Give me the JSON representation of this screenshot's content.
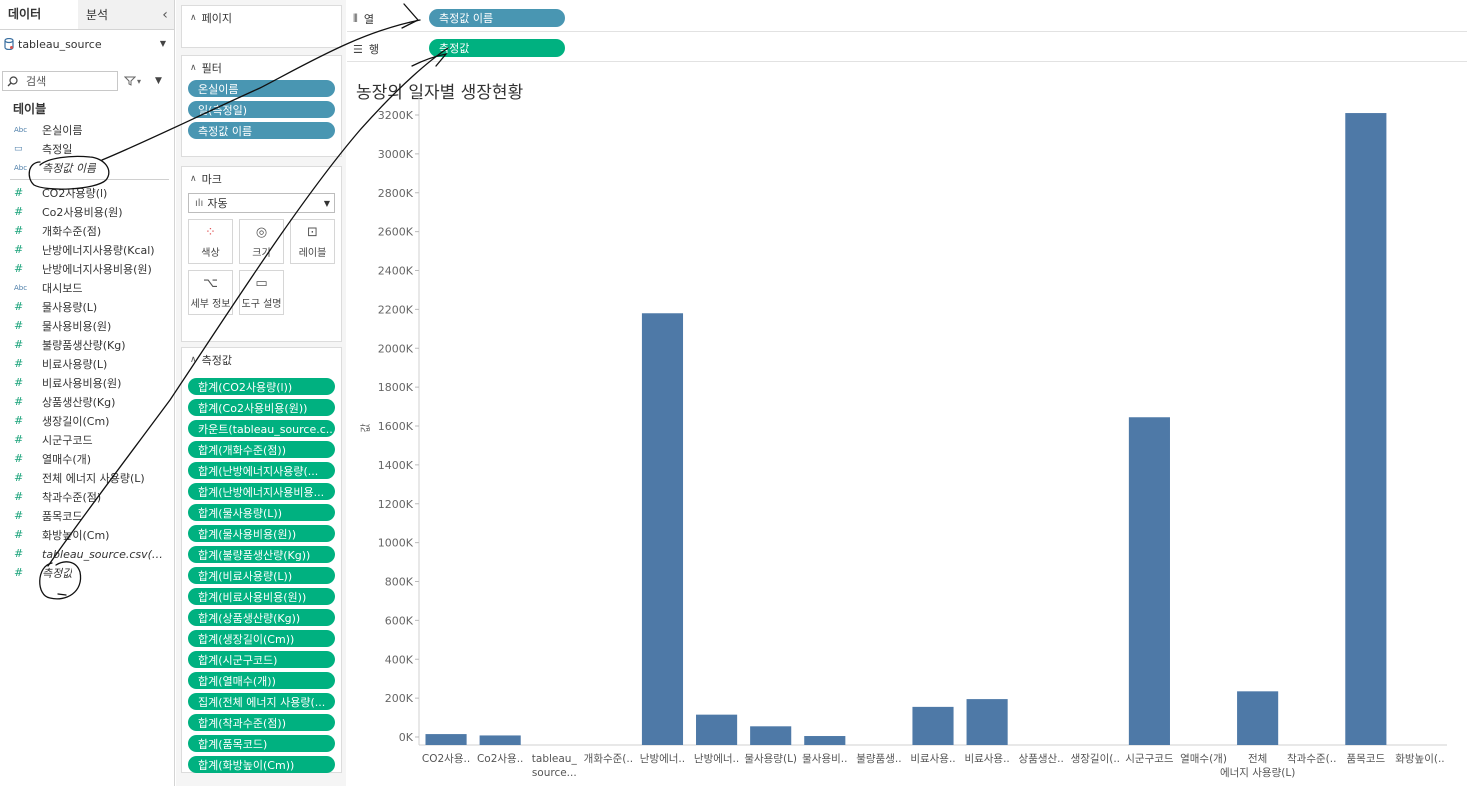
{
  "data_pane": {
    "tabs": [
      "데이터",
      "분석"
    ],
    "source_name": "tableau_source",
    "search_placeholder": "검색",
    "tables_header": "테이블",
    "fields": [
      {
        "type": "abc",
        "name": "온실이름"
      },
      {
        "type": "cal",
        "name": "측정일"
      },
      {
        "type": "abc",
        "name": "측정값 이름",
        "italic": true,
        "sep_after": true
      },
      {
        "type": "num",
        "name": "CO2사용량(l)"
      },
      {
        "type": "num",
        "name": "Co2사용비용(원)"
      },
      {
        "type": "num",
        "name": "개화수준(점)"
      },
      {
        "type": "num",
        "name": "난방에너지사용량(Kcal)"
      },
      {
        "type": "num",
        "name": "난방에너지사용비용(원)"
      },
      {
        "type": "abc",
        "name": "대시보드"
      },
      {
        "type": "num",
        "name": "물사용량(L)"
      },
      {
        "type": "num",
        "name": "물사용비용(원)"
      },
      {
        "type": "num",
        "name": "불량품생산량(Kg)"
      },
      {
        "type": "num",
        "name": "비료사용량(L)"
      },
      {
        "type": "num",
        "name": "비료사용비용(원)"
      },
      {
        "type": "num",
        "name": "상품생산량(Kg)"
      },
      {
        "type": "num",
        "name": "생장길이(Cm)"
      },
      {
        "type": "num",
        "name": "시군구코드"
      },
      {
        "type": "num",
        "name": "열매수(개)"
      },
      {
        "type": "num",
        "name": "전체 에너지 사용량(L)"
      },
      {
        "type": "num",
        "name": "착과수준(점)"
      },
      {
        "type": "num",
        "name": "품목코드"
      },
      {
        "type": "num",
        "name": "화방높이(Cm)"
      },
      {
        "type": "num",
        "name": "tableau_source.csv(카...",
        "italic": true
      },
      {
        "type": "num",
        "name": "측정값",
        "italic": true
      }
    ]
  },
  "cards": {
    "pages": "페이지",
    "filters": "필터",
    "filter_pills": [
      "온실이름",
      "일(측정일)",
      "측정값 이름"
    ],
    "marks": "마크",
    "marks_type": "자동",
    "mark_buttons": [
      "색상",
      "크기",
      "레이블",
      "세부 정보",
      "도구 설명"
    ],
    "measures": "측정값",
    "measure_pills": [
      "합계(CO2사용량(l))",
      "합계(Co2사용비용(원))",
      "카운트(tableau_source.c...",
      "합계(개화수준(점))",
      "합계(난방에너지사용량(...",
      "합계(난방에너지사용비용...",
      "합계(물사용량(L))",
      "합계(물사용비용(원))",
      "합계(불량품생산량(Kg))",
      "합계(비료사용량(L))",
      "합계(비료사용비용(원))",
      "합계(상품생산량(Kg))",
      "합계(생장길이(Cm))",
      "합계(시군구코드)",
      "합계(열매수(개))",
      "집계(전체 에너지 사용량(...",
      "합계(착과수준(점))",
      "합계(품목코드)",
      "합계(화방높이(Cm))"
    ]
  },
  "shelves": {
    "columns_label": "열",
    "columns_pill": "측정값 이름",
    "rows_label": "행",
    "rows_pill": "측정값"
  },
  "viz": {
    "title": "농장의 일자별 생장현황"
  },
  "colors": {
    "bar": "#4e79a7",
    "pill_blue": "#4996b2",
    "pill_green": "#00b180"
  },
  "chart_data": {
    "type": "bar",
    "title": "농장의 일자별 생장현황",
    "ylabel": "값",
    "xlabel": "",
    "ylim": [
      0,
      3200000
    ],
    "yticks": [
      "0K",
      "200K",
      "400K",
      "600K",
      "800K",
      "1000K",
      "1200K",
      "1400K",
      "1600K",
      "1800K",
      "2000K",
      "2200K",
      "2400K",
      "2600K",
      "2800K",
      "3000K",
      "3200K"
    ],
    "categories": [
      "CO2사용..",
      "Co2사용..",
      "tableau_ source...",
      "개화수준(..",
      "난방에너..",
      "난방에너..",
      "물사용량(L)",
      "물사용비..",
      "불량품생..",
      "비료사용..",
      "비료사용..",
      "상품생산..",
      "생장길이(..",
      "시군구코드",
      "열매수(개)",
      "전체 에너지 사용량(L)",
      "착과수준(..",
      "품목코드",
      "화방높이(.."
    ],
    "values": [
      15000,
      8000,
      0,
      0,
      2180000,
      115000,
      55000,
      5000,
      0,
      155000,
      195000,
      0,
      0,
      1645000,
      0,
      235000,
      0,
      3210000,
      0
    ]
  }
}
